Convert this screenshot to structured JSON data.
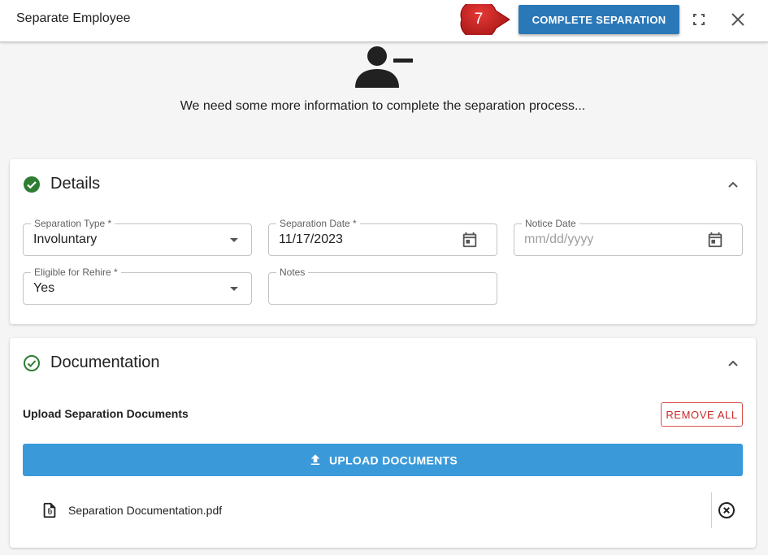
{
  "header": {
    "title": "Separate Employee",
    "step_number": "7",
    "complete_button": "COMPLETE SEPARATION"
  },
  "intro_text": "We need some more information to complete the separation process...",
  "details": {
    "title": "Details",
    "fields": {
      "separation_type": {
        "label": "Separation Type *",
        "value": "Involuntary"
      },
      "separation_date": {
        "label": "Separation Date *",
        "value": "11/17/2023"
      },
      "notice_date": {
        "label": "Notice Date",
        "placeholder": "mm/dd/yyyy"
      },
      "eligible_rehire": {
        "label": "Eligible for Rehire *",
        "value": "Yes"
      },
      "notes": {
        "label": "Notes",
        "value": ""
      }
    }
  },
  "documentation": {
    "title": "Documentation",
    "upload_label": "Upload Separation Documents",
    "remove_all": "REMOVE ALL",
    "upload_button": "UPLOAD DOCUMENTS",
    "files": [
      {
        "name": "Separation Documentation.pdf"
      }
    ]
  },
  "colors": {
    "primary": "#2b78b8",
    "upload": "#3a9ad9",
    "success": "#2e7d32",
    "danger": "#c62828",
    "step_badge": "#c62828"
  },
  "icons": [
    "fullscreen-icon",
    "close-icon",
    "person-remove-icon",
    "check-circle-icon",
    "chevron-up-icon",
    "calendar-icon",
    "upload-icon",
    "attachment-icon",
    "remove-circle-icon"
  ]
}
